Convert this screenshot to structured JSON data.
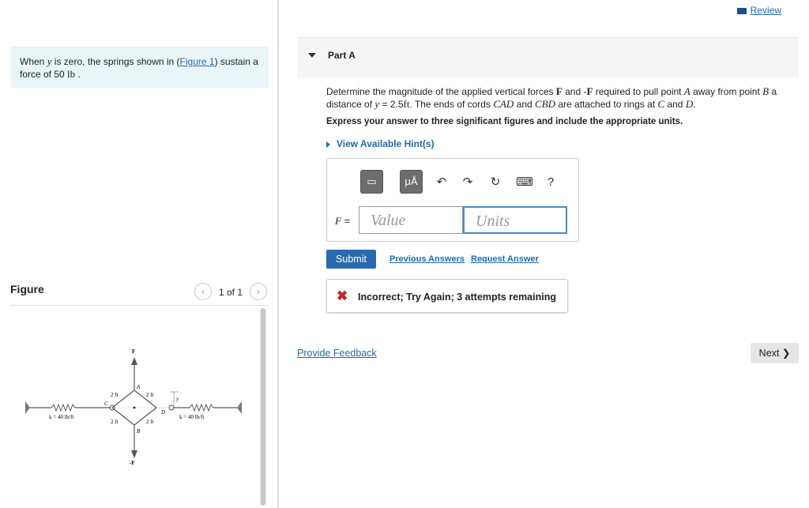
{
  "left_pane": {
    "intro": {
      "prefix": "When ",
      "var": "y",
      "mid": " is zero, the springs shown in (",
      "figure_link": "Figure 1",
      "suffix": ") sustain a force of 50 ",
      "unit": "lb",
      "end": " ."
    },
    "figure": {
      "title": "Figure",
      "pager": "1 of 1",
      "prev_icon": "‹",
      "next_icon": "›",
      "labels": {
        "F_top": "F",
        "F_bottom": "-F",
        "A": "A",
        "B": "B",
        "C": "C",
        "D": "D",
        "y": "y",
        "k_left": "k = 40 lb/ft",
        "k_right": "k = 40 lb/ft",
        "dim_2ft": "2 ft"
      }
    }
  },
  "right_pane": {
    "review_label": "Review",
    "part_title": "Part A",
    "question": {
      "t1": "Determine the magnitude of the applied vertical forces ",
      "F": "F",
      "t2": " and -",
      "F2": "F",
      "t3": " required to pull point ",
      "A": "A",
      "t4": " away from point ",
      "B": "B",
      "t5": " a distance of ",
      "y": "y",
      "t6": " = 2.5",
      "ft": "ft",
      "t7": ". The ends of cords ",
      "CAD": "CAD",
      "t8": " and ",
      "CBD": "CBD",
      "t9": " are attached to rings at ",
      "C": "C",
      "t10": " and ",
      "D": "D",
      "t11": "."
    },
    "instruction": "Express your answer to three significant figures and include the appropriate units.",
    "hints_label": "View Available Hint(s)",
    "toolbar": {
      "template_btn": "▭",
      "units_btn": "μÅ",
      "undo": "↶",
      "redo": "↷",
      "reset": "↻",
      "keyboard": "⌨",
      "help": "?"
    },
    "answer": {
      "label_var": "F",
      "label_eq": " =",
      "value_placeholder": "Value",
      "units_placeholder": "Units"
    },
    "submit_label": "Submit",
    "previous_answers": "Previous Answers",
    "request_answer": "Request Answer",
    "feedback": {
      "icon": "✖",
      "text": "Incorrect; Try Again; 3 attempts remaining"
    },
    "provide_feedback": "Provide Feedback",
    "next_label": "Next ❯"
  },
  "colors": {
    "link": "#1f6bb0",
    "submit_bg": "#2a6bb0",
    "error": "#c0272d",
    "intro_bg": "#eaf5f8"
  }
}
